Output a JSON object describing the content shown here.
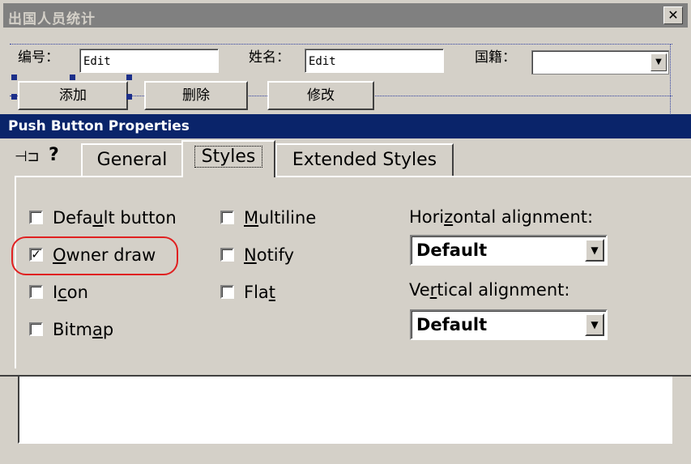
{
  "background_dialog": {
    "title": "出国人员统计",
    "close_glyph": "✕",
    "labels": {
      "number": "编号：",
      "name": "姓名：",
      "nationality": "国籍："
    },
    "edit1_value": "Edit",
    "edit2_value": "Edit",
    "buttons": {
      "add": "添加",
      "delete": "删除",
      "modify": "修改"
    }
  },
  "properties": {
    "title": "Push Button Properties",
    "pin_icon": "⊣⊐",
    "help_icon": "?",
    "tabs": [
      {
        "label": "General",
        "active": false
      },
      {
        "label": "Styles",
        "active": true
      },
      {
        "label": "Extended Styles",
        "active": false
      }
    ],
    "checkboxes": {
      "default_button": {
        "pre": "Defa",
        "u": "u",
        "post": "lt button",
        "checked": false
      },
      "owner_draw": {
        "pre": "",
        "u": "O",
        "post": "wner draw",
        "checked": true
      },
      "icon": {
        "pre": "I",
        "u": "c",
        "post": "on",
        "checked": false
      },
      "bitmap": {
        "pre": "Bitm",
        "u": "a",
        "post": "p",
        "checked": false
      },
      "multiline": {
        "pre": "",
        "u": "M",
        "post": "ultiline",
        "checked": false
      },
      "notify": {
        "pre": "",
        "u": "N",
        "post": "otify",
        "checked": false
      },
      "flat": {
        "pre": "Fla",
        "u": "t",
        "post": "",
        "checked": false
      }
    },
    "horizontal_alignment": {
      "pre": "Hori",
      "u": "z",
      "post": "ontal alignment:",
      "value": "Default"
    },
    "vertical_alignment": {
      "pre": "Ve",
      "u": "r",
      "post": "tical  alignment:",
      "value": "Default"
    },
    "check_glyph": "✓",
    "arrow_glyph": "▼"
  },
  "colors": {
    "titlebar_active": "#0a246a",
    "titlebar_inactive": "#808080",
    "highlight": "#e02020",
    "face": "#d4d0c8"
  }
}
